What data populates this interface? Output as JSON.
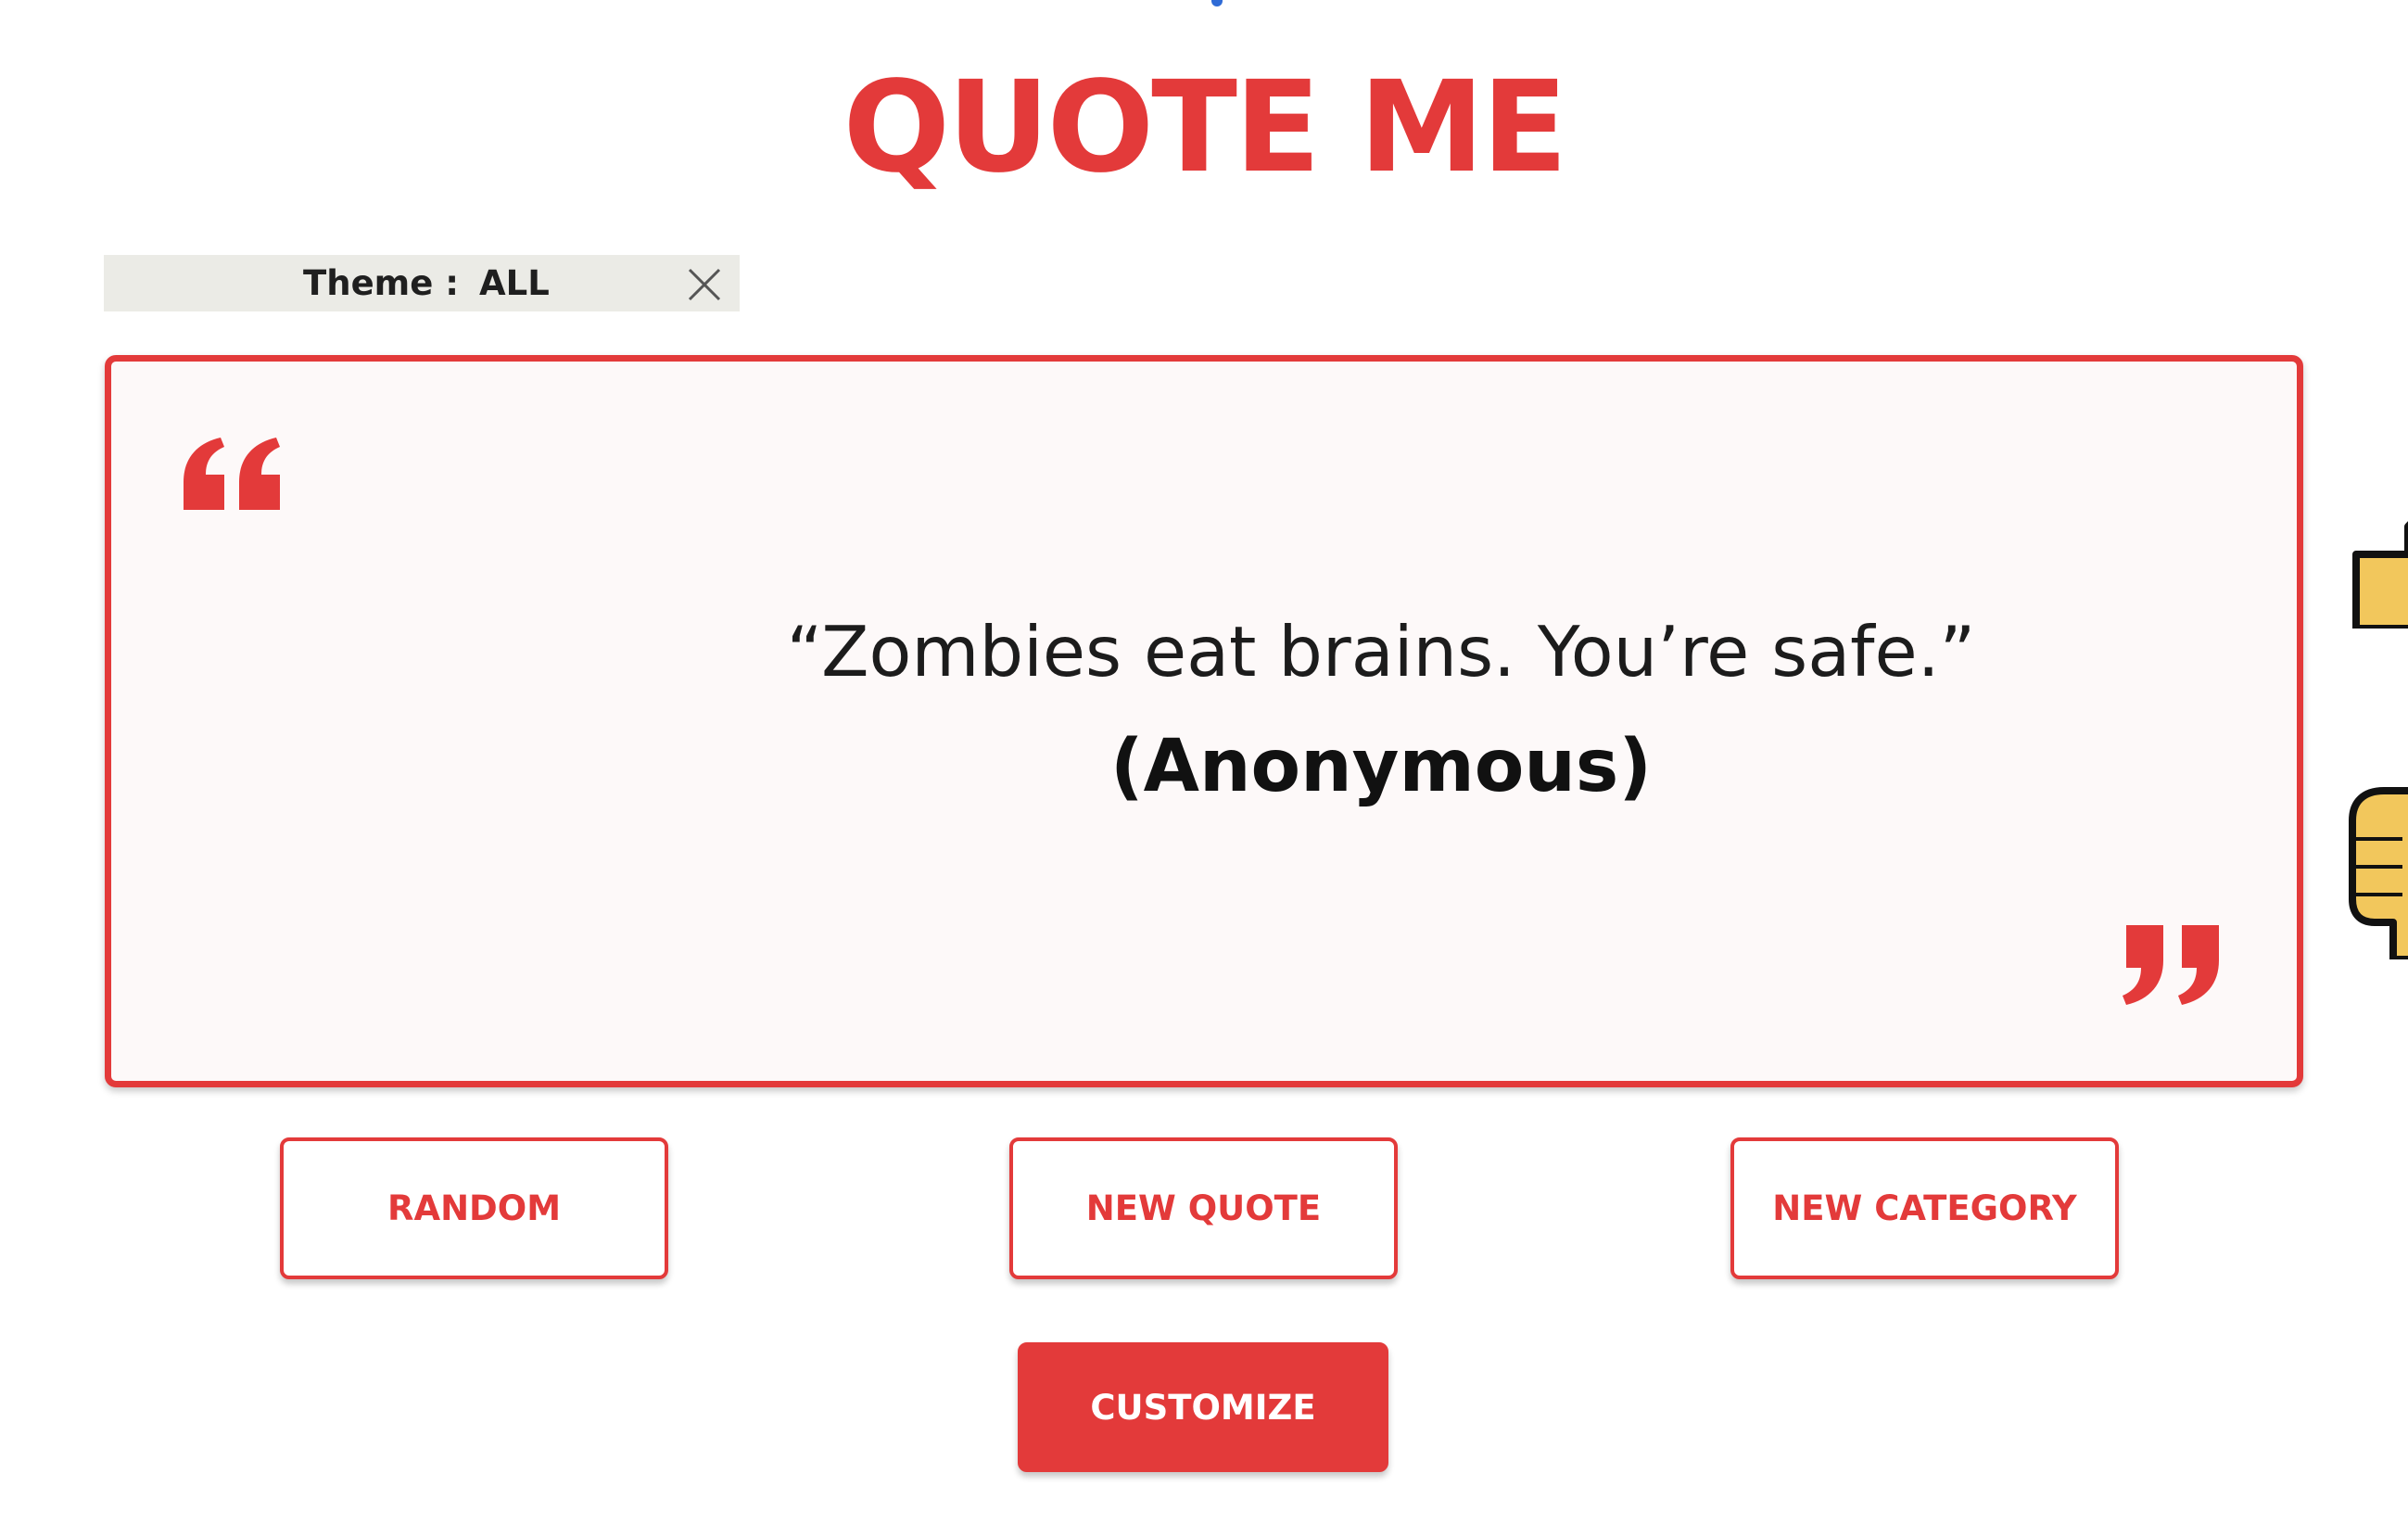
{
  "app": {
    "title": "QUOTE ME"
  },
  "theme": {
    "label": "Theme :",
    "value": "ALL",
    "close_icon": "close-icon"
  },
  "quote": {
    "text": "“Zombies eat brains. You’re safe.”",
    "author": "(Anonymous)",
    "open_icon": "quote-open-icon",
    "close_icon": "quote-close-icon"
  },
  "buttons": {
    "random": "RANDOM",
    "new_quote": "NEW QUOTE",
    "new_category": "NEW CATEGORY",
    "customize": "CUSTOMIZE"
  },
  "rating": {
    "up_icon": "thumbs-up-icon",
    "down_icon": "thumbs-down-icon"
  },
  "colors": {
    "accent": "#e33a3a",
    "card_background": "#fdf9f9",
    "theme_bar": "#ebebe6",
    "thumb": "#f2c75c"
  }
}
